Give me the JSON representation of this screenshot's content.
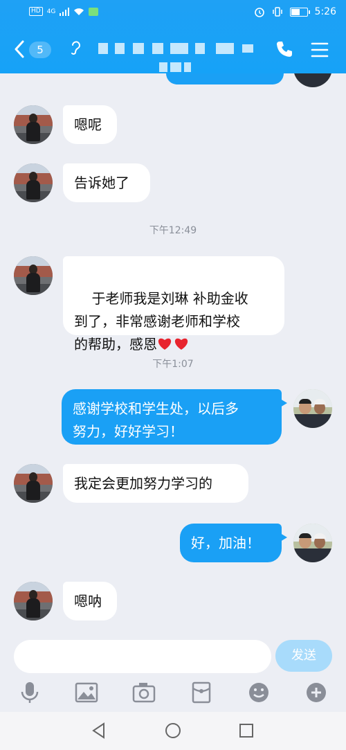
{
  "status_bar": {
    "network": "4G",
    "time": "5:26",
    "hd_label": "HD"
  },
  "header": {
    "unread_count": "5",
    "colors": {
      "header_blue": "#1fa1f5",
      "outgoing_bubble": "#1aa0f5"
    }
  },
  "messages": [
    {
      "type": "in",
      "text": "嗯呢"
    },
    {
      "type": "in",
      "text": "告诉她了"
    },
    {
      "type": "time",
      "text": "下午12:49"
    },
    {
      "type": "in",
      "text": "于老师我是刘琳 补助金收\n到了，非常感谢老师和学校\n的帮助，感恩"
    },
    {
      "type": "time",
      "text": "下午1:07"
    },
    {
      "type": "out",
      "text": "感谢学校和学生处，以后多\n努力，好好学习！"
    },
    {
      "type": "in",
      "text": "我定会更加努力学习的"
    },
    {
      "type": "out",
      "text": "好，加油！"
    },
    {
      "type": "in",
      "text": "嗯呐"
    }
  ],
  "input": {
    "value": "",
    "send_label": "发送"
  },
  "toolbar_icons": [
    "microphone-icon",
    "image-icon",
    "camera-icon",
    "red-packet-icon",
    "emoji-icon",
    "plus-icon"
  ]
}
